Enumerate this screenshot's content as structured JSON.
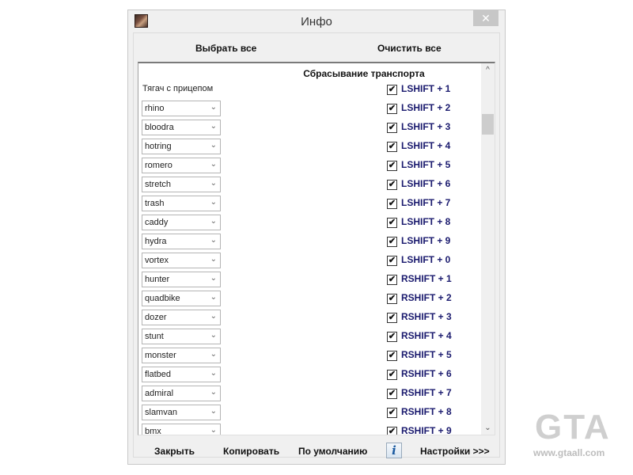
{
  "window": {
    "title": "Инфо",
    "close_label": "✕",
    "app_icon": "app-icon"
  },
  "toolbar": {
    "select_all_label": "Выбрать все",
    "clear_all_label": "Очистить все"
  },
  "list": {
    "section_title": "Сбрасывание транспорта",
    "rows": [
      {
        "type": "label",
        "label": "Тягач с прицепом",
        "hotkey": "LSHIFT + 1",
        "checked": true
      },
      {
        "type": "combo",
        "vehicle": "rhino",
        "hotkey": "LSHIFT + 2",
        "checked": true
      },
      {
        "type": "combo",
        "vehicle": "bloodra",
        "hotkey": "LSHIFT + 3",
        "checked": true
      },
      {
        "type": "combo",
        "vehicle": "hotring",
        "hotkey": "LSHIFT + 4",
        "checked": true
      },
      {
        "type": "combo",
        "vehicle": "romero",
        "hotkey": "LSHIFT + 5",
        "checked": true
      },
      {
        "type": "combo",
        "vehicle": "stretch",
        "hotkey": "LSHIFT + 6",
        "checked": true
      },
      {
        "type": "combo",
        "vehicle": "trash",
        "hotkey": "LSHIFT + 7",
        "checked": true
      },
      {
        "type": "combo",
        "vehicle": "caddy",
        "hotkey": "LSHIFT + 8",
        "checked": true
      },
      {
        "type": "combo",
        "vehicle": "hydra",
        "hotkey": "LSHIFT + 9",
        "checked": true
      },
      {
        "type": "combo",
        "vehicle": "vortex",
        "hotkey": "LSHIFT + 0",
        "checked": true
      },
      {
        "type": "combo",
        "vehicle": "hunter",
        "hotkey": "RSHIFT + 1",
        "checked": true
      },
      {
        "type": "combo",
        "vehicle": "quadbike",
        "hotkey": "RSHIFT + 2",
        "checked": true
      },
      {
        "type": "combo",
        "vehicle": "dozer",
        "hotkey": "RSHIFT + 3",
        "checked": true
      },
      {
        "type": "combo",
        "vehicle": "stunt",
        "hotkey": "RSHIFT + 4",
        "checked": true
      },
      {
        "type": "combo",
        "vehicle": "monster",
        "hotkey": "RSHIFT + 5",
        "checked": true
      },
      {
        "type": "combo",
        "vehicle": "flatbed",
        "hotkey": "RSHIFT + 6",
        "checked": true
      },
      {
        "type": "combo",
        "vehicle": "admiral",
        "hotkey": "RSHIFT + 7",
        "checked": true
      },
      {
        "type": "combo",
        "vehicle": "slamvan",
        "hotkey": "RSHIFT + 8",
        "checked": true
      },
      {
        "type": "combo",
        "vehicle": "bmx",
        "hotkey": "RSHIFT + 9",
        "checked": true
      }
    ],
    "check_glyph": "✔",
    "combo_arrow_glyph": "⌄",
    "scroll_up_glyph": "^",
    "scroll_down_glyph": "⌄"
  },
  "footer": {
    "close_label": "Закрыть",
    "copy_label": "Копировать",
    "default_label": "По умолчанию",
    "info_label": "i",
    "settings_label": "Настройки >>>"
  },
  "watermark": {
    "logo_text": "GTA",
    "url": "www.gtaall.com"
  },
  "colors": {
    "hotkey_text": "#1a1a6e",
    "window_bg": "#f0f0f0",
    "list_bg": "#ffffff"
  }
}
